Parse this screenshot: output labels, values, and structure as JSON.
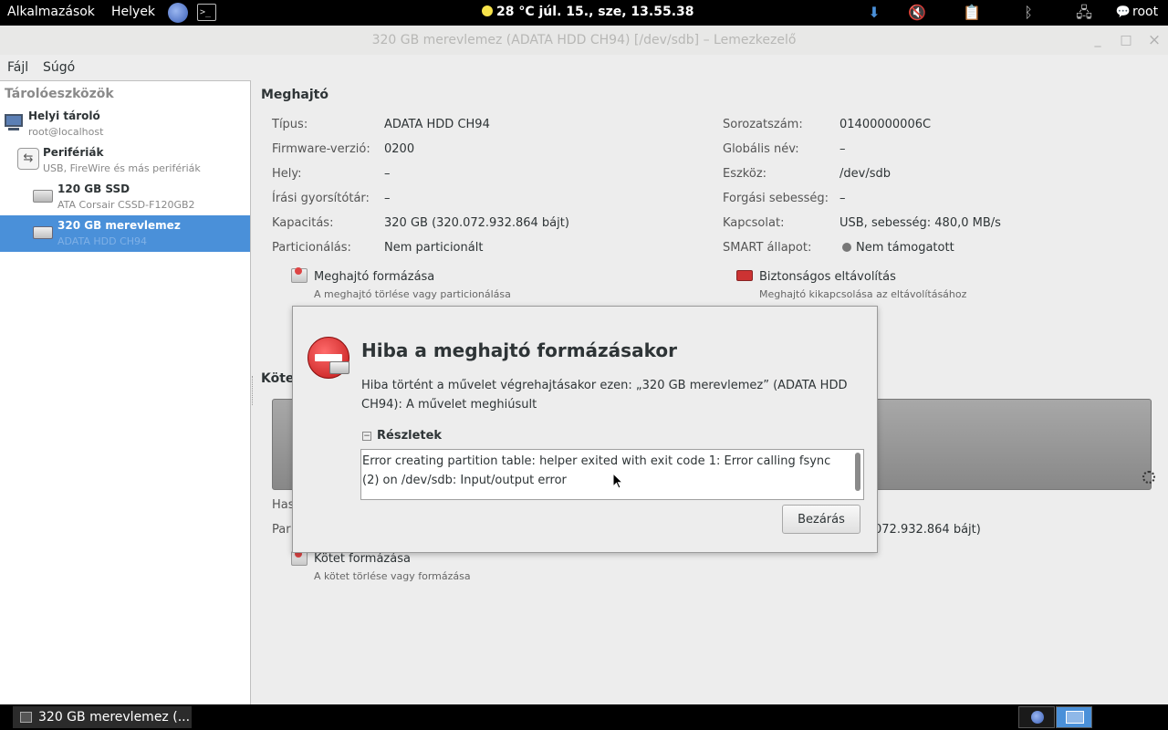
{
  "top_panel": {
    "applications": "Alkalmazások",
    "places": "Helyek",
    "clock": "28 °C  júl. 15., sze, 13.55.38",
    "user": "root",
    "icons": [
      "download-icon",
      "volume-muted-icon",
      "clipboard-icon",
      "bluetooth-icon",
      "network-icon",
      "chat-icon"
    ]
  },
  "window": {
    "title": "320 GB merevlemez (ADATA HDD CH94) [/dev/sdb] – Lemezkezelő",
    "minimize": "_",
    "maximize": "□",
    "close": "×"
  },
  "menubar": {
    "file": "Fájl",
    "help": "Súgó"
  },
  "sidebar": {
    "title": "Tárolóeszközök",
    "items": [
      {
        "name": "Helyi tároló",
        "sub": "root@localhost"
      },
      {
        "name": "Perifériák",
        "sub": "USB, FireWire és más perifériák"
      },
      {
        "name": "120 GB SSD",
        "sub": "ATA Corsair CSSD-F120GB2"
      },
      {
        "name": "320 GB merevlemez",
        "sub": "ADATA HDD CH94"
      }
    ]
  },
  "drive": {
    "section": "Meghajtó",
    "left": [
      {
        "label": "Típus:",
        "value": "ADATA HDD CH94"
      },
      {
        "label": "Firmware-verzió:",
        "value": "0200"
      },
      {
        "label": "Hely:",
        "value": "–"
      },
      {
        "label": "Írási gyorsítótár:",
        "value": "–"
      },
      {
        "label": "Kapacitás:",
        "value": "320 GB (320.072.932.864 bájt)"
      },
      {
        "label": "Particionálás:",
        "value": "Nem particionált"
      }
    ],
    "right": [
      {
        "label": "Sorozatszám:",
        "value": "01400000006C"
      },
      {
        "label": "Globális név:",
        "value": "–"
      },
      {
        "label": "Eszköz:",
        "value": "/dev/sdb"
      },
      {
        "label": "Forgási sebesség:",
        "value": "–"
      },
      {
        "label": "Kapcsolat:",
        "value": "USB, sebesség: 480,0 MB/s"
      },
      {
        "label": "SMART állapot:",
        "value": "Nem támogatott"
      }
    ],
    "actions": {
      "format_title": "Meghajtó formázása",
      "format_sub": "A meghajtó törlése vagy particionálása",
      "eject_title": "Biztonságos eltávolítás",
      "eject_sub": "Meghajtó kikapcsolása az eltávolításához"
    }
  },
  "volumes": {
    "section_partial": "Köte",
    "usage_partial": "Has",
    "partition_partial": "Par",
    "capacity_partial": "072.932.864 bájt)",
    "format_title": "Kötet formázása",
    "format_sub": "A kötet törlése vagy formázása"
  },
  "dialog": {
    "title": "Hiba a meghajtó formázásakor",
    "message": "Hiba történt a művelet végrehajtásakor ezen: „320 GB merevlemez” (ADATA HDD CH94): A művelet meghiúsult",
    "details_label": "Részletek",
    "details_toggle": "−",
    "details_text": "Error creating partition table: helper exited with exit code 1: Error calling fsync (2) on /dev/sdb: Input/output error",
    "close_button": "Bezárás"
  },
  "taskbar": {
    "task": "320 GB merevlemez (..."
  }
}
